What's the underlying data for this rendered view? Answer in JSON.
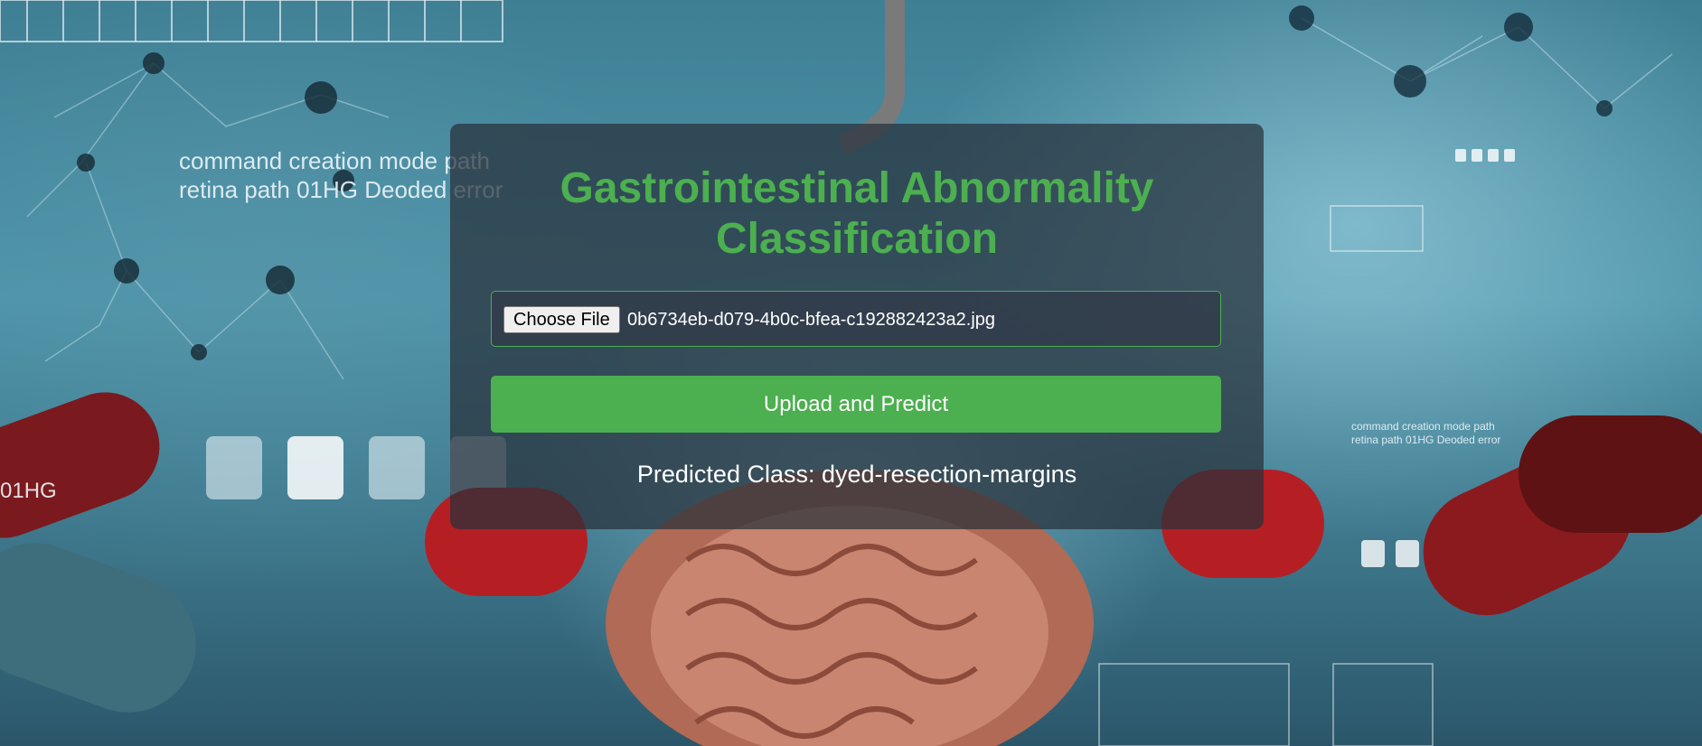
{
  "background": {
    "texts": [
      "command creation mode path",
      "retina path 01HG Deoded error",
      "01HG",
      "command creation mode path",
      "retina path 01HG Deoded error"
    ]
  },
  "app": {
    "title": "Gastrointestinal Abnormality Classification"
  },
  "upload": {
    "choose_label": "Choose File",
    "file_name": "0b6734eb-d079-4b0c-bfea-c192882423a2.jpg",
    "submit_label": "Upload and Predict"
  },
  "result": {
    "text": "Predicted Class: dyed-resection-margins"
  },
  "colors": {
    "accent": "#4caf50",
    "panel": "#28303a"
  }
}
